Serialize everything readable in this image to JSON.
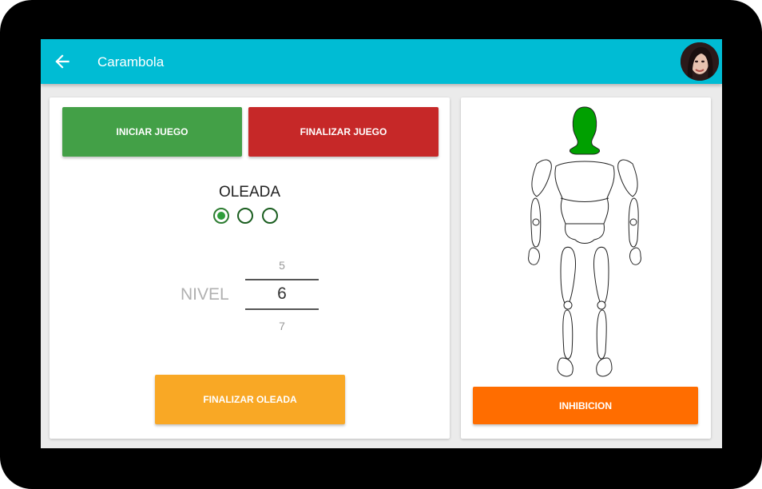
{
  "appbar": {
    "title": "Carambola",
    "back_icon": "arrow-left-icon",
    "background": "#00bcd4"
  },
  "game": {
    "start_label": "INICIAR JUEGO",
    "end_label": "FINALIZAR JUEGO",
    "wave_title": "OLEADA",
    "wave_options_count": 3,
    "wave_selected_index": 0,
    "level_label": "NIVEL",
    "level_prev": "5",
    "level_current": "6",
    "level_next": "7",
    "end_wave_label": "FINALIZAR OLEADA"
  },
  "body_panel": {
    "head_color": "#00a000",
    "inhibition_label": "INHIBICION"
  },
  "colors": {
    "start": "#43a047",
    "end": "#c62828",
    "end_wave": "#f9a825",
    "inhibition": "#ff6d00"
  }
}
